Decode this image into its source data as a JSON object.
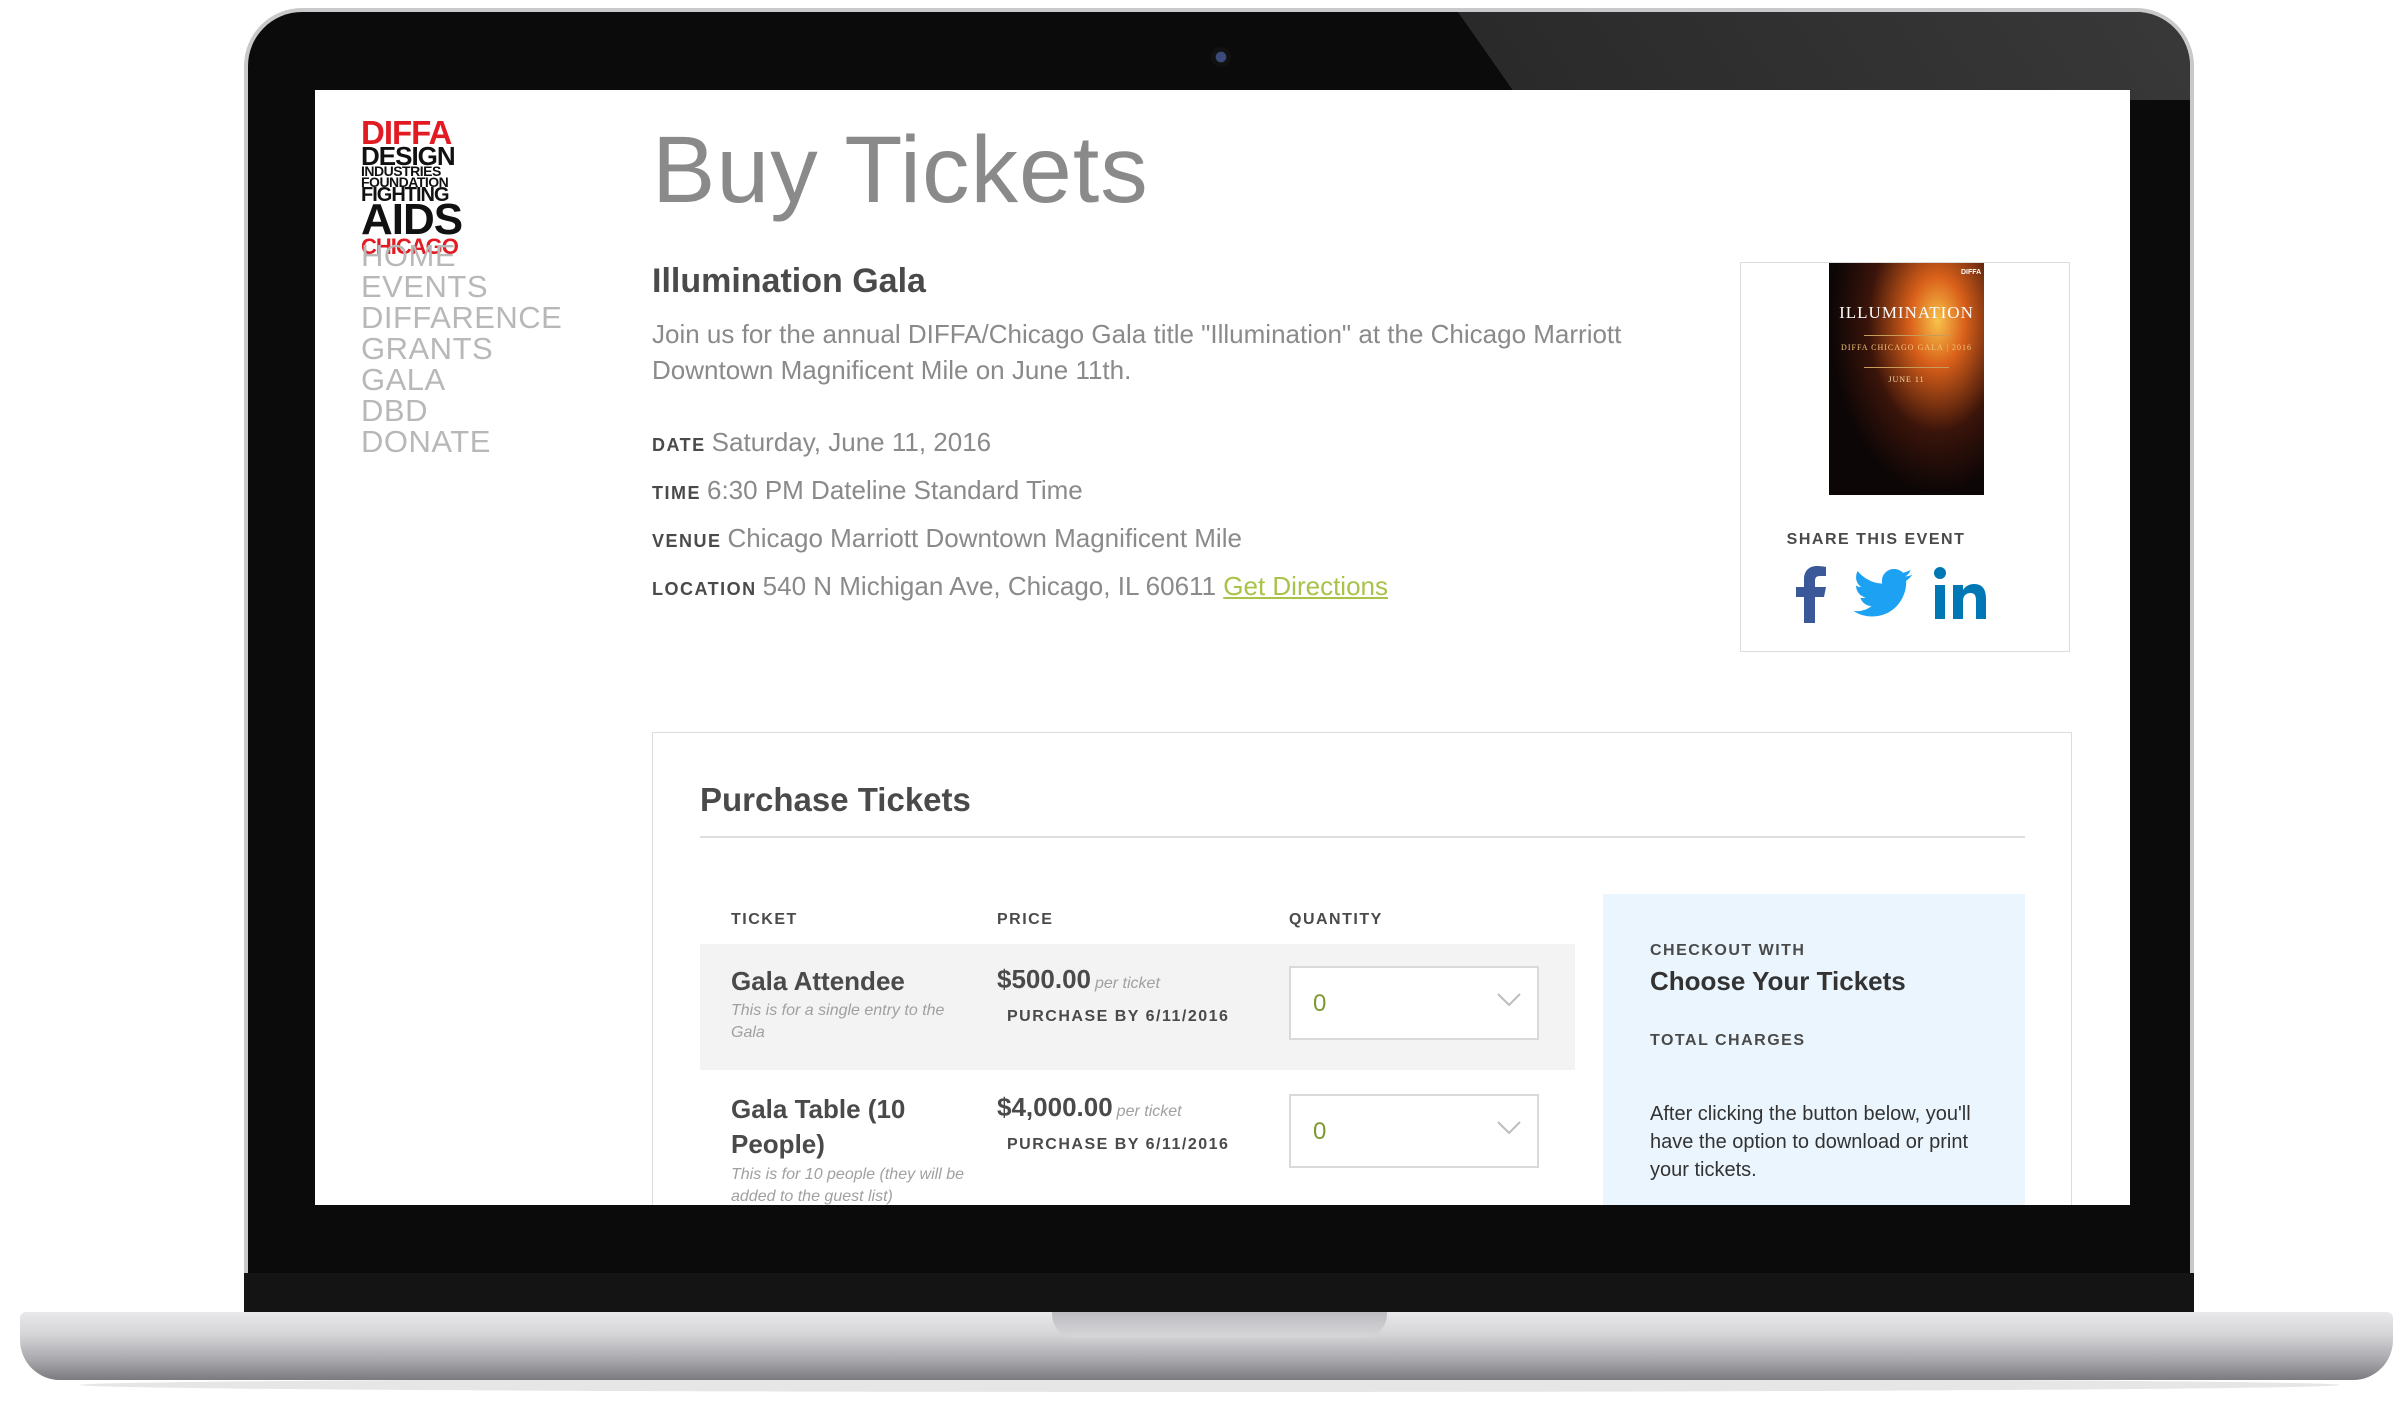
{
  "logo": {
    "lines": [
      "DIFFA",
      "DESIGN",
      "INDUSTRIES",
      "FOUNDATION",
      "FIGHTING",
      "AIDS",
      "CHICAGO"
    ]
  },
  "nav": {
    "items": [
      "HOME",
      "EVENTS",
      "DIFFARENCE",
      "GRANTS",
      "GALA",
      "DBD",
      "DONATE"
    ]
  },
  "page": {
    "title": "Buy Tickets"
  },
  "event": {
    "name": "Illumination Gala",
    "description": "Join us for the annual DIFFA/Chicago Gala title \"Illumination\" at the Chicago Marriott Downtown Magnificent Mile on June 11th.",
    "date_label": "DATE",
    "date": "Saturday, June 11, 2016",
    "time_label": "TIME",
    "time": "6:30 PM Dateline Standard Time",
    "venue_label": "VENUE",
    "venue": "Chicago Marriott Downtown Magnificent Mile",
    "location_label": "LOCATION",
    "location": "540 N Michigan Ave, Chicago, IL 60611",
    "directions_link": "Get Directions"
  },
  "share": {
    "label": "SHARE THIS EVENT",
    "poster_title": "ILLUMINATION",
    "poster_subtitle": "DIFFA CHICAGO GALA | 2016",
    "poster_date": "JUNE 11",
    "poster_logo": "DIFFA",
    "icons": [
      "facebook-icon",
      "twitter-icon",
      "linkedin-icon"
    ],
    "colors": {
      "facebook": "#3b5998",
      "twitter": "#1da1f2",
      "linkedin": "#0077b5"
    }
  },
  "purchase": {
    "title": "Purchase Tickets",
    "columns": {
      "ticket": "TICKET",
      "price": "PRICE",
      "quantity": "QUANTITY"
    },
    "tickets": [
      {
        "name": "Gala Attendee",
        "description": "This is for a single entry to the Gala",
        "price": "$500.00",
        "per": "per ticket",
        "purchase_by": "PURCHASE BY 6/11/2016",
        "quantity": "0"
      },
      {
        "name": "Gala Table (10 People)",
        "description": "This is for 10 people (they will be added to the guest list)",
        "price": "$4,000.00",
        "per": "per ticket",
        "purchase_by": "PURCHASE BY 6/11/2016",
        "quantity": "0"
      }
    ]
  },
  "checkout": {
    "label": "CHECKOUT WITH",
    "choose": "Choose Your Tickets",
    "total_label": "TOTAL CHARGES",
    "note": "After clicking the button below, you'll have the option to download or print your tickets."
  },
  "colors": {
    "accent_link": "#a8c24a",
    "logo_red": "#e21b23",
    "checkout_bg": "#eaf5fd",
    "quantity_value": "#7d9a2f"
  }
}
